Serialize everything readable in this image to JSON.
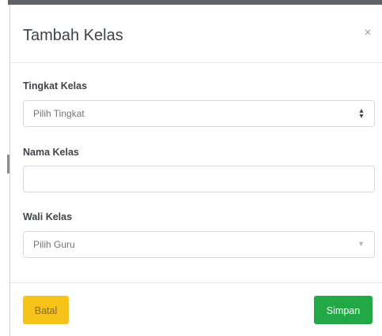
{
  "modal": {
    "title": "Tambah Kelas",
    "close_icon": "×"
  },
  "form": {
    "tingkat": {
      "label": "Tingkat Kelas",
      "selected": "Pilih Tingkat",
      "icon": "sort-arrows-icon"
    },
    "nama": {
      "label": "Nama Kelas",
      "value": ""
    },
    "wali": {
      "label": "Wali Kelas",
      "selected": "Pilih Guru",
      "icon": "chevron-down-icon"
    }
  },
  "footer": {
    "cancel_label": "Batal",
    "save_label": "Simpan"
  },
  "colors": {
    "cancel_button": "#f7c21a",
    "save_button": "#23a846"
  }
}
